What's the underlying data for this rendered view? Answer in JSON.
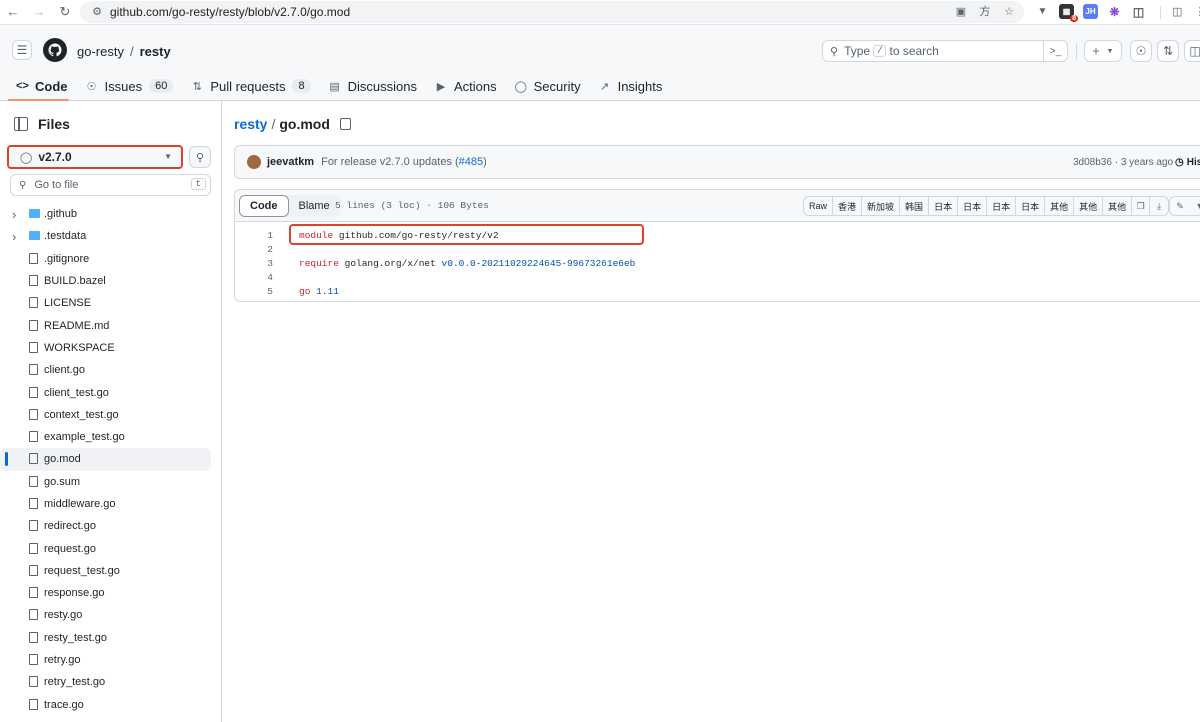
{
  "browser": {
    "url": "github.com/go-resty/resty/blob/v2.7.0/go.mod",
    "ext_badge": "8",
    "ext_jh": "JH"
  },
  "header": {
    "owner": "go-resty",
    "separator": "/",
    "repo": "resty",
    "search_prefix": "Type",
    "search_key": "/",
    "search_suffix": "to search",
    "plus": "+",
    "tabs": [
      {
        "label": "Code",
        "icon": "code-icon"
      },
      {
        "label": "Issues",
        "count": "60",
        "icon": "issue-icon"
      },
      {
        "label": "Pull requests",
        "count": "8",
        "icon": "pull-request-icon"
      },
      {
        "label": "Discussions",
        "icon": "discussion-icon"
      },
      {
        "label": "Actions",
        "icon": "play-icon"
      },
      {
        "label": "Security",
        "icon": "shield-icon"
      },
      {
        "label": "Insights",
        "icon": "graph-icon"
      }
    ]
  },
  "sidebar": {
    "title": "Files",
    "branch": "v2.7.0",
    "goto_placeholder": "Go to file",
    "goto_key": "t",
    "items": [
      {
        "name": ".github",
        "type": "folder"
      },
      {
        "name": ".testdata",
        "type": "folder"
      },
      {
        "name": ".gitignore",
        "type": "file"
      },
      {
        "name": "BUILD.bazel",
        "type": "file"
      },
      {
        "name": "LICENSE",
        "type": "file"
      },
      {
        "name": "README.md",
        "type": "file"
      },
      {
        "name": "WORKSPACE",
        "type": "file"
      },
      {
        "name": "client.go",
        "type": "file"
      },
      {
        "name": "client_test.go",
        "type": "file"
      },
      {
        "name": "context_test.go",
        "type": "file"
      },
      {
        "name": "example_test.go",
        "type": "file"
      },
      {
        "name": "go.mod",
        "type": "file",
        "selected": true
      },
      {
        "name": "go.sum",
        "type": "file"
      },
      {
        "name": "middleware.go",
        "type": "file"
      },
      {
        "name": "redirect.go",
        "type": "file"
      },
      {
        "name": "request.go",
        "type": "file"
      },
      {
        "name": "request_test.go",
        "type": "file"
      },
      {
        "name": "response.go",
        "type": "file"
      },
      {
        "name": "resty.go",
        "type": "file"
      },
      {
        "name": "resty_test.go",
        "type": "file"
      },
      {
        "name": "retry.go",
        "type": "file"
      },
      {
        "name": "retry_test.go",
        "type": "file"
      },
      {
        "name": "trace.go",
        "type": "file"
      }
    ]
  },
  "main": {
    "path_dir": "resty",
    "path_sep": "/",
    "path_file": "go.mod",
    "commit": {
      "author": "jeevatkm",
      "message": "For release v2.7.0 updates (",
      "pr": "#485",
      "message_end": ")",
      "sha_time": "3d08b36 · 3 years ago",
      "history": "His"
    },
    "file": {
      "tab_code": "Code",
      "tab_blame": "Blame",
      "info": "5 lines (3 loc) · 106 Bytes",
      "raw": "Raw",
      "translate_buttons": [
        "香港",
        "新加坡",
        "韩国",
        "日本",
        "日本",
        "日本",
        "日本",
        "其他",
        "其他",
        "其他"
      ],
      "lines": [
        {
          "n": "1",
          "kw": "module",
          "rest": " github.com/go-resty/resty/v2",
          "lit": ""
        },
        {
          "n": "2",
          "kw": "",
          "rest": "",
          "lit": ""
        },
        {
          "n": "3",
          "kw": "require",
          "rest": " golang.org/x/net ",
          "lit": "v0.0.0-20211029224645-99673261e6eb"
        },
        {
          "n": "4",
          "kw": "",
          "rest": "",
          "lit": ""
        },
        {
          "n": "5",
          "kw": "go",
          "rest": " ",
          "lit": "1.11"
        }
      ]
    }
  }
}
